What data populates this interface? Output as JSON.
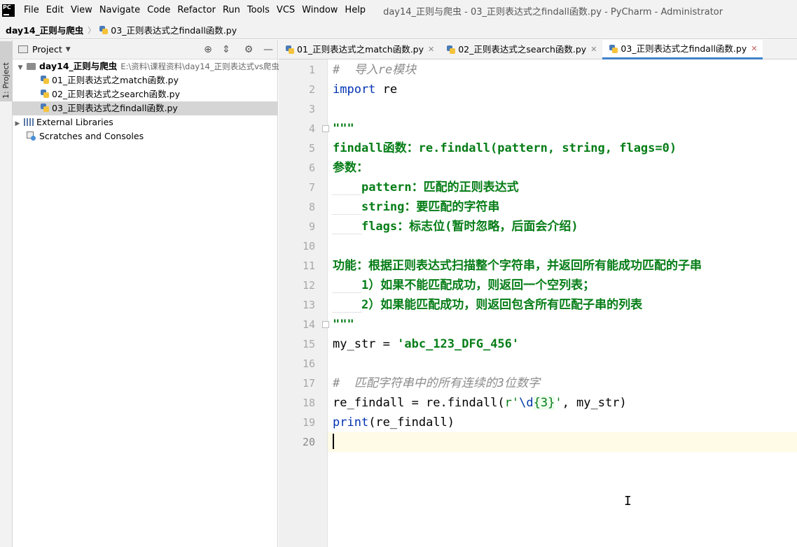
{
  "menubar": {
    "logo": "PC",
    "items": [
      "File",
      "Edit",
      "View",
      "Navigate",
      "Code",
      "Refactor",
      "Run",
      "Tools",
      "VCS",
      "Window",
      "Help"
    ],
    "title": "day14_正则与爬虫 - 03_正则表达式之findall函数.py - PyCharm - Administrator"
  },
  "breadcrumb": {
    "project": "day14_正则与爬虫",
    "file": "03_正则表达式之findall函数.py"
  },
  "left_strip": {
    "project_tab": "1: Project"
  },
  "project_panel": {
    "title": "Project",
    "root": {
      "name": "day14_正则与爬虫",
      "path": "E:\\资料\\课程资料\\day14_正则表达式vs爬虫"
    },
    "files": [
      "01_正则表达式之match函数.py",
      "02_正则表达式之search函数.py",
      "03_正则表达式之findall函数.py"
    ],
    "external_libraries": "External Libraries",
    "scratches": "Scratches and Consoles"
  },
  "editor_tabs": [
    {
      "label": "01_正则表达式之match函数.py",
      "active": false
    },
    {
      "label": "02_正则表达式之search函数.py",
      "active": false
    },
    {
      "label": "03_正则表达式之findall函数.py",
      "active": true
    }
  ],
  "editor": {
    "line_numbers": [
      "1",
      "2",
      "3",
      "4",
      "5",
      "6",
      "7",
      "8",
      "9",
      "10",
      "11",
      "12",
      "13",
      "14",
      "15",
      "16",
      "17",
      "18",
      "19",
      "20"
    ],
    "current_line": "20",
    "code": {
      "l1": "#  导入re模块",
      "l2_kw": "import",
      "l2_rest": " re",
      "l4": "\"\"\"",
      "l5": "findall函数：re.findall(pattern, string, flags=0)",
      "l6": "参数：",
      "l7_ind": "    ",
      "l7": "pattern：匹配的正则表达式",
      "l8_ind": "    ",
      "l8": "string：要匹配的字符串",
      "l9_ind": "    ",
      "l9": "flags：标志位(暂时忽略，后面会介绍)",
      "l11": "功能：根据正则表达式扫描整个字符串，并返回所有能成功匹配的子串",
      "l12_ind": "    ",
      "l12": "1）如果不能匹配成功，则返回一个空列表；",
      "l13_ind": "    ",
      "l13": "2）如果能匹配成功，则返回包含所有匹配子串的列表",
      "l14": "\"\"\"",
      "l15_a": "my_str = ",
      "l15_b": "'abc_123_DFG_456'",
      "l17": "#  匹配字符串中的所有连续的3位数字",
      "l18_a": "re_findall = re.findall(",
      "l18_b": "r'",
      "l18_c": "\\d",
      "l18_d": "{3}",
      "l18_e": "'",
      "l18_f": ", my_str)",
      "l19_kw": "print",
      "l19_rest": "(re_findall)"
    }
  },
  "colors": {
    "keyword": "#0033b3",
    "string": "#067d17",
    "comment": "#8c8c8c",
    "active_tab_underline": "#4083c9"
  }
}
